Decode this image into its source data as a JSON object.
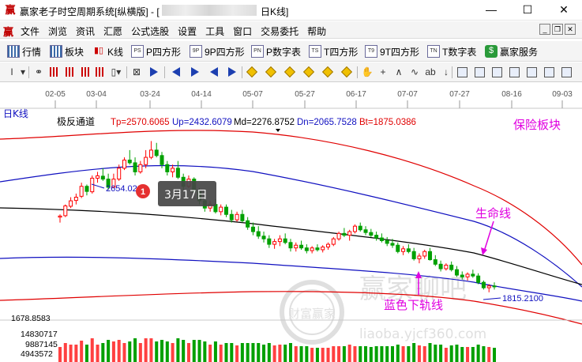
{
  "window": {
    "title_left": "赢家老子时空周期系统[纵横版] - [",
    "title_right": "日K线]",
    "minimize": "—",
    "maximize": "☐",
    "close": "✕"
  },
  "menu": {
    "logo": "赢",
    "items": [
      "文件",
      "浏览",
      "资讯",
      "汇愿",
      "公式选股",
      "设置",
      "工具",
      "窗口",
      "交易委托",
      "帮助"
    ],
    "mdi_min": "_",
    "mdi_restore": "❐",
    "mdi_close": "✕"
  },
  "toolbar1": {
    "items": [
      {
        "label": "行情",
        "icon": "quote-grid-icon",
        "badge": ""
      },
      {
        "label": "板块",
        "icon": "sector-icon",
        "badge": ""
      },
      {
        "label": "K线",
        "icon": "kline-icon",
        "badge": "▮▯"
      },
      {
        "label": "P四方形",
        "icon": "p-square-icon",
        "badge": "PS"
      },
      {
        "label": "9P四方形",
        "icon": "9p-square-icon",
        "badge": "9P"
      },
      {
        "label": "P数字表",
        "icon": "p-number-table-icon",
        "badge": "PN"
      },
      {
        "label": "T四方形",
        "icon": "t-square-icon",
        "badge": "TS"
      },
      {
        "label": "9T四方形",
        "icon": "9t-square-icon",
        "badge": "T9"
      },
      {
        "label": "T数字表",
        "icon": "t-number-table-icon",
        "badge": "TN"
      },
      {
        "label": "赢家服务",
        "icon": "service-icon",
        "badge": "$"
      }
    ]
  },
  "chart_header": {
    "period_label": "日K线",
    "indicator": "极反通道",
    "tp": "Tp=2570.6065",
    "up": "Up=2432.6079",
    "md": "Md=2276.8752",
    "dn": "Dn=2065.7528",
    "bt": "Bt=1875.0386",
    "sector_name": "保险板块"
  },
  "x_axis_dates": [
    "02-05",
    "03-04",
    "03-24",
    "04-14",
    "05-07",
    "05-27",
    "06-17",
    "07-07",
    "07-27",
    "08-16",
    "09-03"
  ],
  "annotations": {
    "high_label": "2654.0200",
    "tooltip_num": "1",
    "tooltip_text": "3月17日",
    "lifeline_label": "生命线",
    "lower_rail_label": "蓝色下轨线",
    "low_label": "1815.2100"
  },
  "volume_axis": {
    "price_floor": "1678.8583",
    "v1": "14830717",
    "v2": "9887145",
    "v3": "4943572"
  },
  "watermark": {
    "big": "赢家聊吧",
    "url": "liaoba.yjcf360.com",
    "seal": "财富赢家"
  },
  "colors": {
    "up": "#ff0000",
    "down": "#00a000",
    "channel_outer": "#e00000",
    "channel_inner": "#1010c0",
    "mid": "#000000",
    "annotation": "#e000e0"
  },
  "chart_data": {
    "type": "candlestick",
    "price_range": [
      1678.8583,
      2700
    ],
    "candles": [
      [
        2230,
        2245,
        2200,
        2236
      ],
      [
        2238,
        2300,
        2230,
        2292
      ],
      [
        2290,
        2340,
        2280,
        2320
      ],
      [
        2322,
        2360,
        2300,
        2340
      ],
      [
        2345,
        2420,
        2335,
        2400
      ],
      [
        2400,
        2410,
        2350,
        2372
      ],
      [
        2370,
        2460,
        2360,
        2445
      ],
      [
        2445,
        2480,
        2420,
        2458
      ],
      [
        2456,
        2500,
        2430,
        2440
      ],
      [
        2440,
        2470,
        2380,
        2395
      ],
      [
        2395,
        2470,
        2390,
        2440
      ],
      [
        2440,
        2520,
        2430,
        2500
      ],
      [
        2500,
        2560,
        2490,
        2545
      ],
      [
        2545,
        2600,
        2520,
        2530
      ],
      [
        2530,
        2560,
        2460,
        2480
      ],
      [
        2480,
        2540,
        2470,
        2520
      ],
      [
        2520,
        2600,
        2500,
        2560
      ],
      [
        2560,
        2650,
        2550,
        2600
      ],
      [
        2600,
        2640,
        2560,
        2570
      ],
      [
        2570,
        2590,
        2500,
        2520
      ],
      [
        2520,
        2540,
        2460,
        2480
      ],
      [
        2480,
        2520,
        2450,
        2500
      ],
      [
        2500,
        2540,
        2440,
        2450
      ],
      [
        2450,
        2470,
        2380,
        2400
      ],
      [
        2400,
        2460,
        2390,
        2440
      ],
      [
        2440,
        2450,
        2360,
        2370
      ],
      [
        2370,
        2390,
        2300,
        2320
      ],
      [
        2320,
        2340,
        2260,
        2280
      ],
      [
        2280,
        2320,
        2260,
        2300
      ],
      [
        2300,
        2330,
        2250,
        2260
      ],
      [
        2260,
        2300,
        2240,
        2285
      ],
      [
        2285,
        2300,
        2230,
        2245
      ],
      [
        2245,
        2270,
        2200,
        2215
      ],
      [
        2215,
        2260,
        2205,
        2245
      ],
      [
        2245,
        2270,
        2200,
        2210
      ],
      [
        2210,
        2230,
        2160,
        2175
      ],
      [
        2175,
        2200,
        2130,
        2150
      ],
      [
        2150,
        2180,
        2110,
        2125
      ],
      [
        2125,
        2150,
        2090,
        2110
      ],
      [
        2110,
        2130,
        2060,
        2080
      ],
      [
        2080,
        2110,
        2055,
        2095
      ],
      [
        2095,
        2130,
        2070,
        2110
      ],
      [
        2110,
        2140,
        2080,
        2090
      ],
      [
        2090,
        2110,
        2040,
        2060
      ],
      [
        2060,
        2090,
        2040,
        2075
      ],
      [
        2075,
        2100,
        2050,
        2060
      ],
      [
        2060,
        2080,
        2030,
        2045
      ],
      [
        2045,
        2070,
        2030,
        2060
      ],
      [
        2060,
        2080,
        2040,
        2050
      ],
      [
        2050,
        2075,
        2035,
        2065
      ],
      [
        2065,
        2090,
        2050,
        2080
      ],
      [
        2080,
        2120,
        2070,
        2110
      ],
      [
        2110,
        2150,
        2100,
        2140
      ],
      [
        2140,
        2170,
        2120,
        2130
      ],
      [
        2130,
        2160,
        2100,
        2150
      ],
      [
        2150,
        2190,
        2140,
        2180
      ],
      [
        2180,
        2200,
        2150,
        2160
      ],
      [
        2160,
        2180,
        2130,
        2145
      ],
      [
        2145,
        2165,
        2120,
        2130
      ],
      [
        2130,
        2150,
        2100,
        2115
      ],
      [
        2115,
        2140,
        2090,
        2100
      ],
      [
        2100,
        2120,
        2070,
        2085
      ],
      [
        2085,
        2110,
        2060,
        2075
      ],
      [
        2075,
        2090,
        2030,
        2040
      ],
      [
        2040,
        2070,
        2020,
        2055
      ],
      [
        2055,
        2080,
        2030,
        2040
      ],
      [
        2040,
        2060,
        1990,
        2000
      ],
      [
        2000,
        2030,
        1975,
        2015
      ],
      [
        2015,
        2050,
        2000,
        2040
      ],
      [
        2040,
        2060,
        1990,
        1995
      ],
      [
        1995,
        2020,
        1960,
        1970
      ],
      [
        1970,
        1990,
        1930,
        1945
      ],
      [
        1945,
        1975,
        1935,
        1965
      ],
      [
        1965,
        1985,
        1930,
        1940
      ],
      [
        1940,
        1960,
        1900,
        1910
      ],
      [
        1910,
        1930,
        1885,
        1900
      ],
      [
        1900,
        1925,
        1880,
        1915
      ],
      [
        1915,
        1940,
        1895,
        1905
      ],
      [
        1905,
        1920,
        1860,
        1870
      ],
      [
        1870,
        1880,
        1830,
        1840
      ],
      [
        1840,
        1860,
        1815,
        1850
      ],
      [
        1850,
        1870,
        1830,
        1845
      ]
    ]
  }
}
